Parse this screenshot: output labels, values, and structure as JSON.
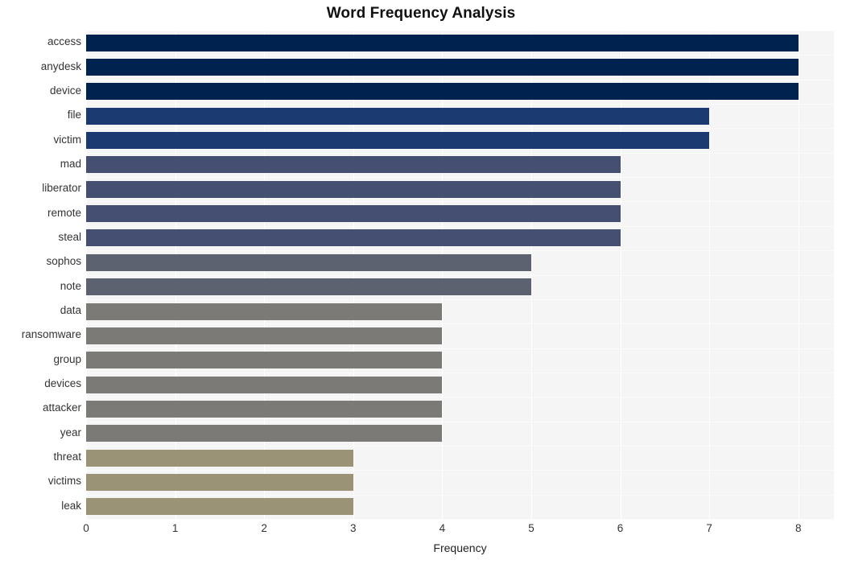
{
  "chart_data": {
    "type": "bar",
    "orientation": "horizontal",
    "title": "Word Frequency Analysis",
    "xlabel": "Frequency",
    "ylabel": "",
    "categories": [
      "access",
      "anydesk",
      "device",
      "file",
      "victim",
      "mad",
      "liberator",
      "remote",
      "steal",
      "sophos",
      "note",
      "data",
      "ransomware",
      "group",
      "devices",
      "attacker",
      "year",
      "threat",
      "victims",
      "leak"
    ],
    "values": [
      8,
      8,
      8,
      7,
      7,
      6,
      6,
      6,
      6,
      5,
      5,
      4,
      4,
      4,
      4,
      4,
      4,
      3,
      3,
      3
    ],
    "bar_colors": [
      "#00224e",
      "#00224e",
      "#00224e",
      "#1c3a72",
      "#1c3a72",
      "#454f72",
      "#454f72",
      "#454f72",
      "#454f72",
      "#5d6270",
      "#5d6270",
      "#7b7a77",
      "#7b7a77",
      "#7b7a77",
      "#7b7a77",
      "#7b7a77",
      "#7b7a77",
      "#9a9375",
      "#9a9375",
      "#9a9375"
    ],
    "xlim": [
      0,
      8.4
    ],
    "xticks": [
      0,
      1,
      2,
      3,
      4,
      5,
      6,
      7,
      8
    ],
    "xtick_labels": [
      "0",
      "1",
      "2",
      "3",
      "4",
      "5",
      "6",
      "7",
      "8"
    ],
    "grid": true,
    "grid_axis": "both",
    "legend": false,
    "plot_background": "#f5f5f5",
    "figure_background": "#ffffff",
    "gridline_color": "#ffffff"
  }
}
